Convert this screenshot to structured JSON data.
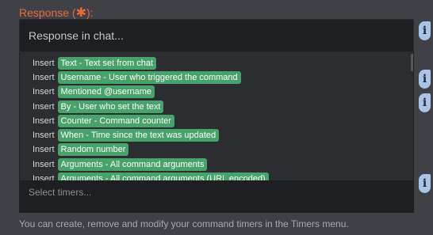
{
  "response": {
    "label_prefix": "Response (",
    "required_mark": "✱",
    "label_suffix": "):",
    "placeholder": "Response in chat..."
  },
  "insert_options": {
    "prefix": "Insert",
    "items": [
      "Text - Text set from chat",
      "Username - User who triggered the command",
      "Mentioned @username",
      "By - User who set the text",
      "Counter - Command counter",
      "When - Time since the text was updated",
      "Random number",
      "Arguments - All command arguments",
      "Arguments - All command arguments (URL encoded)"
    ]
  },
  "timers": {
    "placeholder": "Select timers...",
    "hint": "You can create, remove and modify your command timers in the Timers menu."
  },
  "info_icon_glyph": "i",
  "colors": {
    "background": "#3f4147",
    "label": "#e8693a",
    "pill": "#48a36b",
    "info_icon": "#a9c4e4"
  }
}
